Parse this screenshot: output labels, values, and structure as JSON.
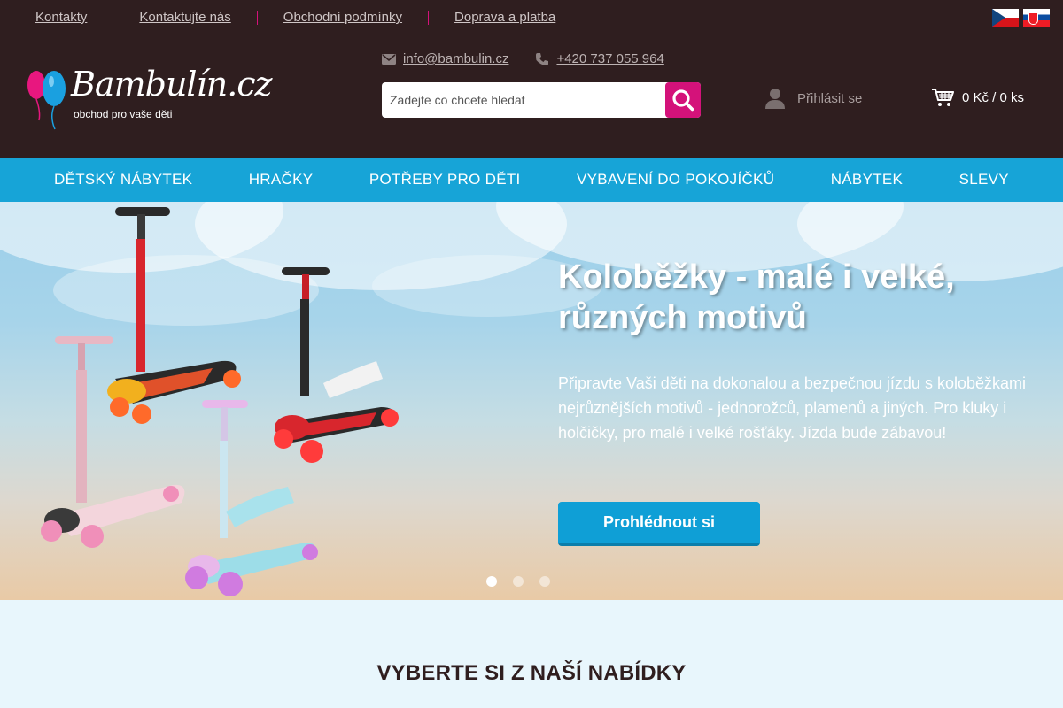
{
  "topbar": {
    "links": [
      "Kontakty",
      "Kontaktujte nás",
      "Obchodní podmínky",
      "Doprava a platba"
    ],
    "languages": [
      "cz-flag",
      "sk-flag"
    ]
  },
  "header": {
    "logo_text": "Bambulín.cz",
    "logo_tagline": "obchod pro vaše děti",
    "email": "info@bambulin.cz",
    "phone": "+420 737 055 964",
    "search_placeholder": "Zadejte co chcete hledat",
    "login_label": "Přihlásit se",
    "cart_summary": "0 Kč / 0 ks"
  },
  "nav": {
    "items": [
      "DĚTSKÝ NÁBYTEK",
      "HRAČKY",
      "POTŘEBY PRO DĚTI",
      "VYBAVENÍ DO POKOJÍČKŮ",
      "NÁBYTEK",
      "SLEVY"
    ]
  },
  "hero": {
    "title": "Koloběžky - malé i velké, různých motivů",
    "text": "Připravte Vaši děti na dokonalou a bezpečnou jízdu s koloběžkami nejrůznějších motivů - jednorožců, plamenů a jiných. Pro kluky i holčičky, pro malé i velké rošťáky. Jízda bude zábavou!",
    "button_label": "Prohlédnout si",
    "slides_count": 3,
    "active_slide": 1
  },
  "offer": {
    "heading": "VYBERTE SI Z NAŠÍ NABÍDKY"
  },
  "colors": {
    "header_bg": "#2f1e1f",
    "accent_pink": "#d4127a",
    "nav_blue": "#17a4d7",
    "button_blue": "#0f9fd6",
    "section_bg": "#e8f6fc"
  }
}
